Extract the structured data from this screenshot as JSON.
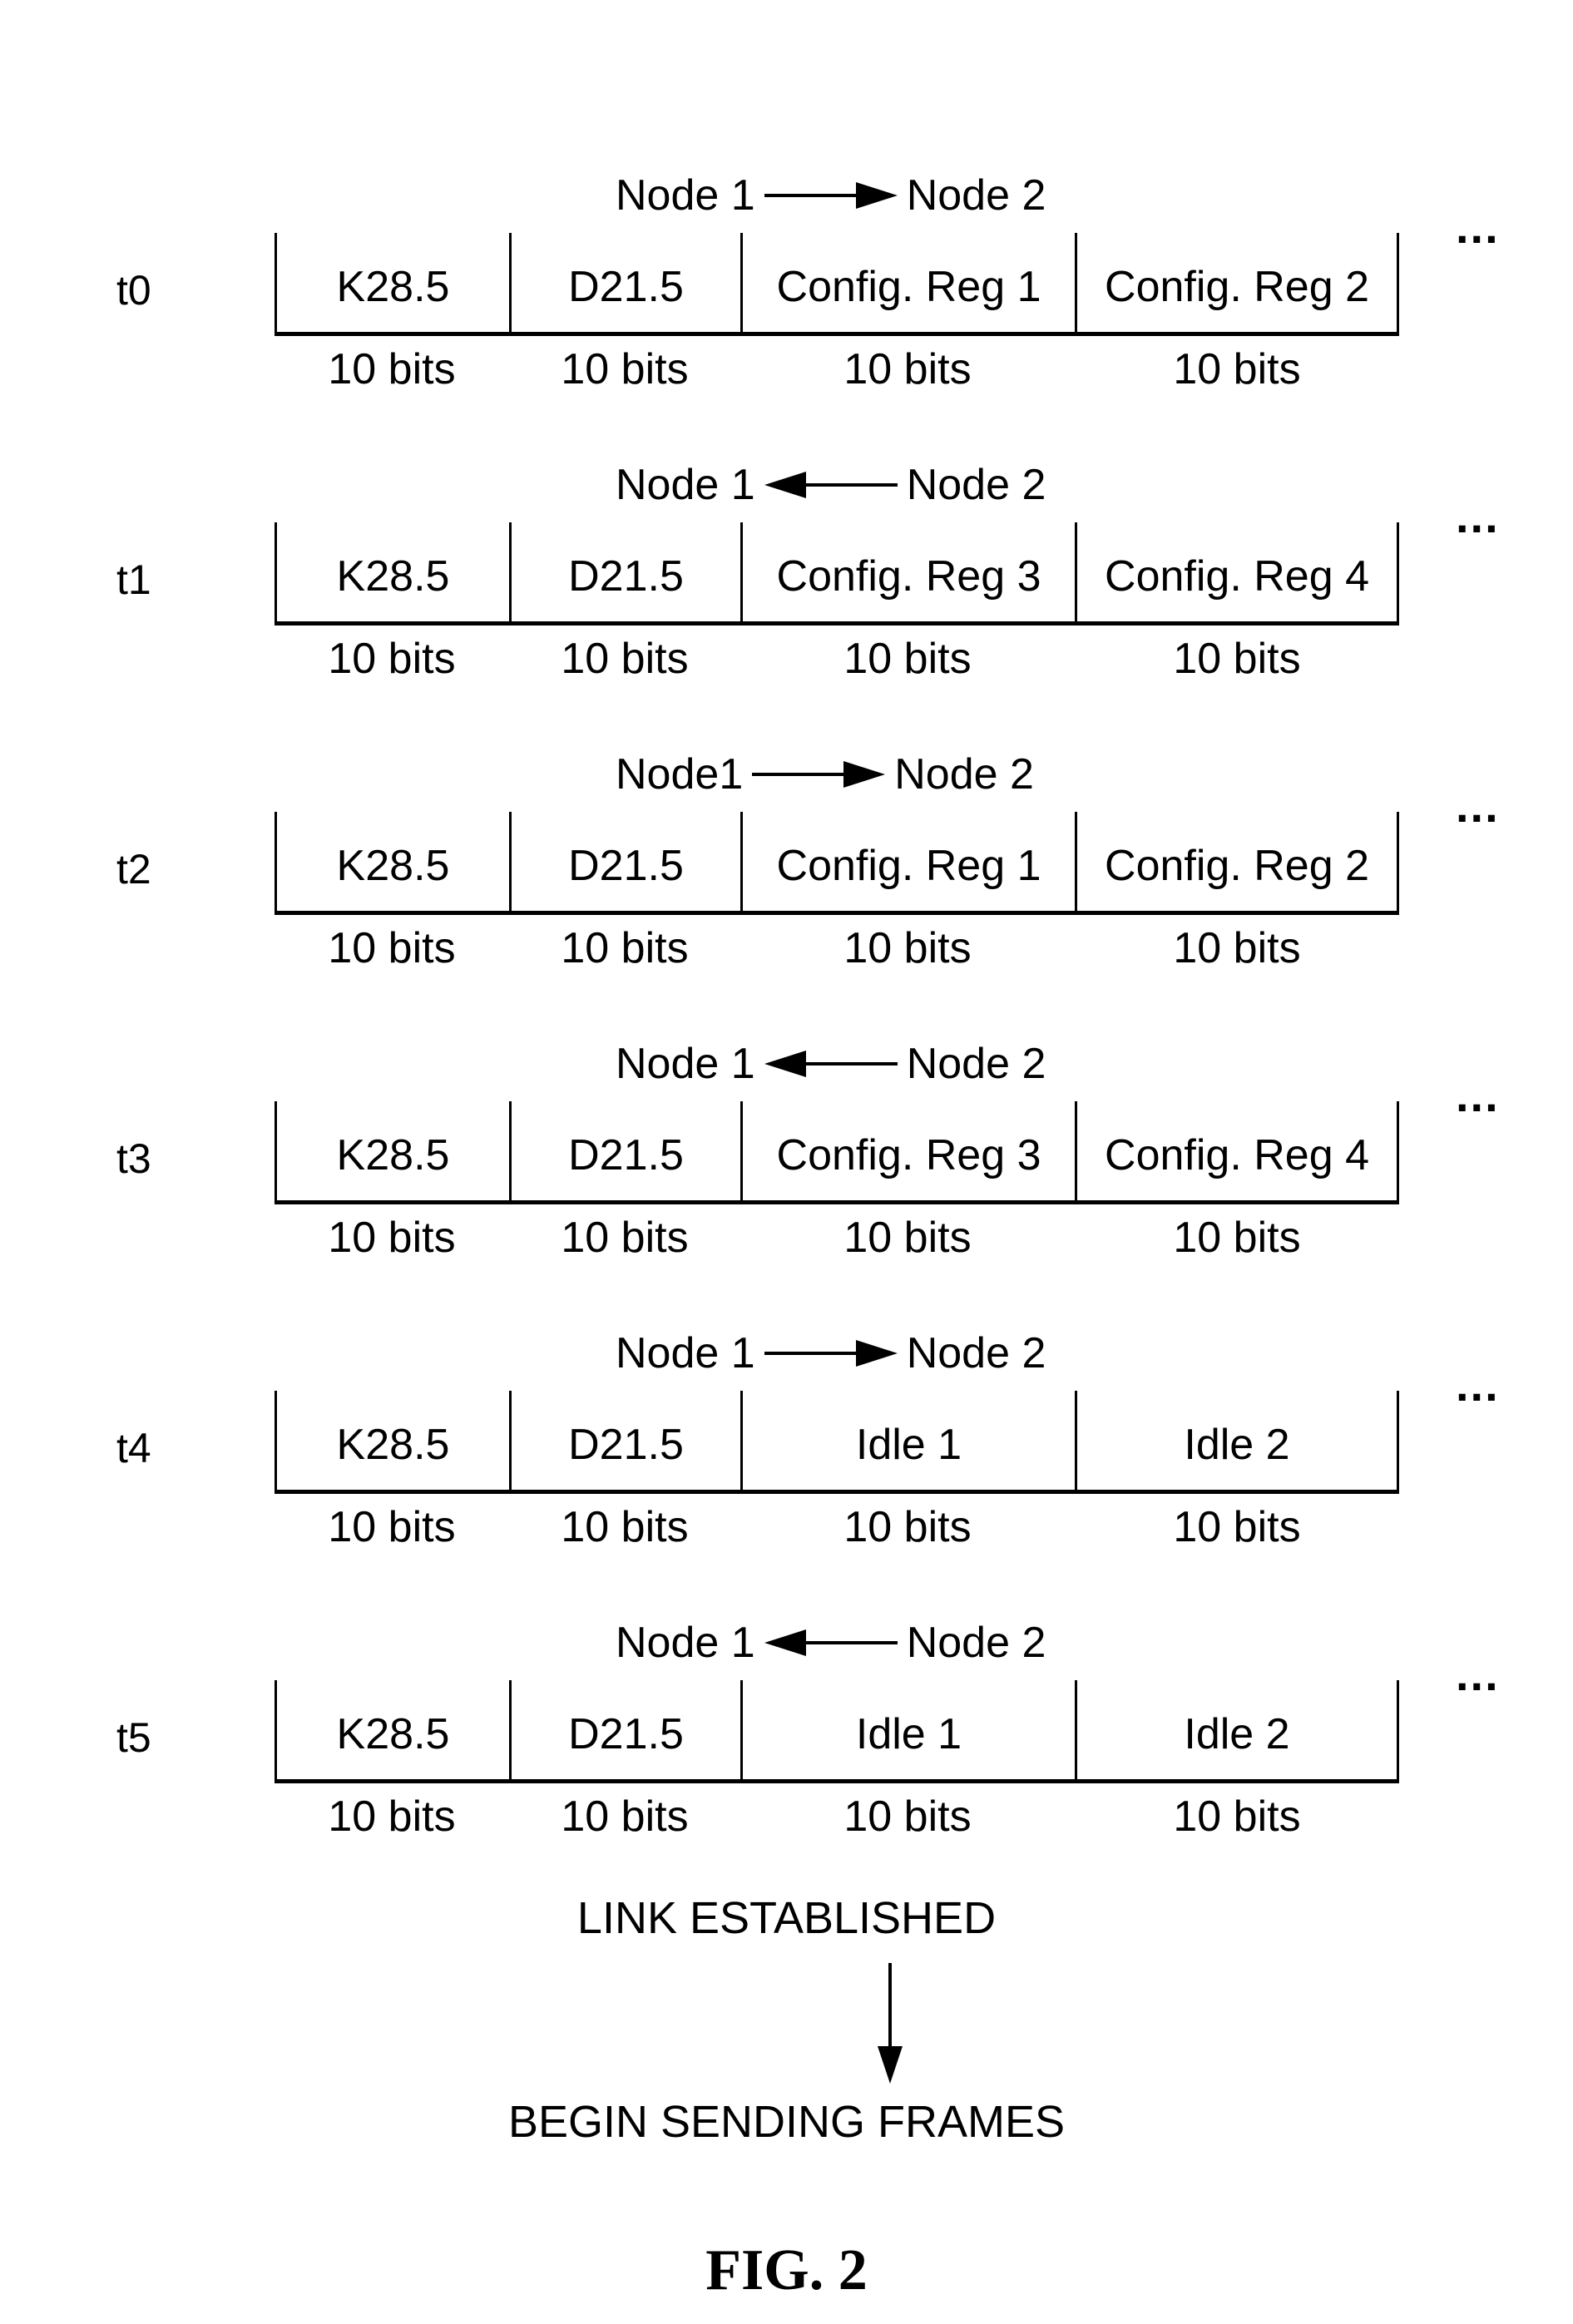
{
  "rows": [
    {
      "time": "t0",
      "from": "Node 1",
      "to": "Node 2",
      "direction": "right",
      "cells": [
        "K28.5",
        "D21.5",
        "Config. Reg 1",
        "Config. Reg 2"
      ],
      "bits": [
        "10 bits",
        "10 bits",
        "10 bits",
        "10 bits"
      ],
      "more": "..."
    },
    {
      "time": "t1",
      "from": "Node 1",
      "to": "Node 2",
      "direction": "left",
      "cells": [
        "K28.5",
        "D21.5",
        "Config. Reg 3",
        "Config. Reg 4"
      ],
      "bits": [
        "10 bits",
        "10 bits",
        "10 bits",
        "10 bits"
      ],
      "more": "..."
    },
    {
      "time": "t2",
      "from": "Node1",
      "to": "Node 2",
      "direction": "right",
      "cells": [
        "K28.5",
        "D21.5",
        "Config. Reg 1",
        "Config. Reg 2"
      ],
      "bits": [
        "10 bits",
        "10 bits",
        "10 bits",
        "10 bits"
      ],
      "more": "..."
    },
    {
      "time": "t3",
      "from": "Node 1",
      "to": "Node 2",
      "direction": "left",
      "cells": [
        "K28.5",
        "D21.5",
        "Config. Reg 3",
        "Config. Reg 4"
      ],
      "bits": [
        "10 bits",
        "10 bits",
        "10 bits",
        "10 bits"
      ],
      "more": "..."
    },
    {
      "time": "t4",
      "from": "Node 1",
      "to": "Node 2",
      "direction": "right",
      "cells": [
        "K28.5",
        "D21.5",
        "Idle 1",
        "Idle 2"
      ],
      "bits": [
        "10 bits",
        "10 bits",
        "10 bits",
        "10 bits"
      ],
      "more": "..."
    },
    {
      "time": "t5",
      "from": "Node 1",
      "to": "Node 2",
      "direction": "left",
      "cells": [
        "K28.5",
        "D21.5",
        "Idle 1",
        "Idle 2"
      ],
      "bits": [
        "10 bits",
        "10 bits",
        "10 bits",
        "10 bits"
      ],
      "more": "..."
    }
  ],
  "footer": {
    "status": "LINK ESTABLISHED",
    "next": "BEGIN SENDING FRAMES"
  },
  "figure_label": "FIG. 2"
}
